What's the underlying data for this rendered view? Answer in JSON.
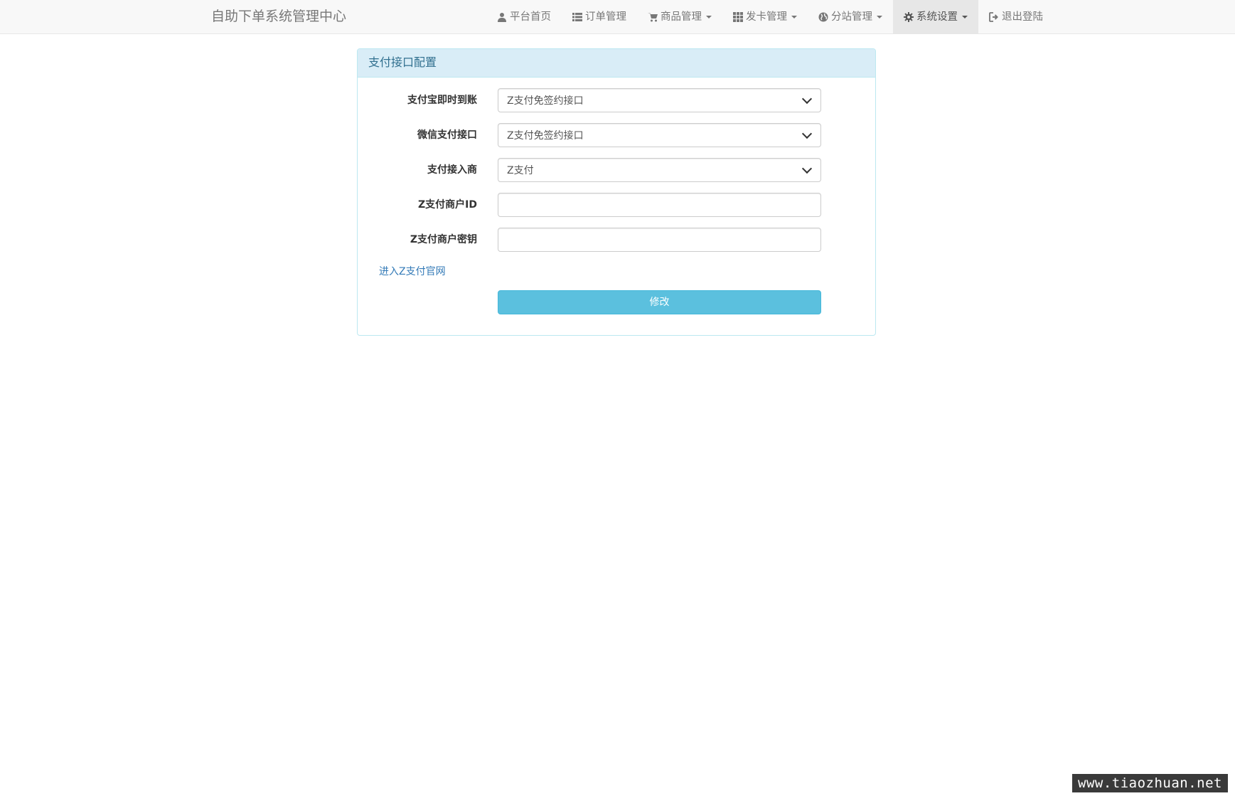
{
  "navbar": {
    "brand": "自助下单系统管理中心",
    "items": [
      {
        "label": "平台首页",
        "icon": "user-icon",
        "dropdown": false,
        "active": false
      },
      {
        "label": "订单管理",
        "icon": "list-icon",
        "dropdown": false,
        "active": false
      },
      {
        "label": "商品管理",
        "icon": "cart-icon",
        "dropdown": true,
        "active": false
      },
      {
        "label": "发卡管理",
        "icon": "grid-icon",
        "dropdown": true,
        "active": false
      },
      {
        "label": "分站管理",
        "icon": "globe-icon",
        "dropdown": true,
        "active": false
      },
      {
        "label": "系统设置",
        "icon": "gear-icon",
        "dropdown": true,
        "active": true
      },
      {
        "label": "退出登陆",
        "icon": "logout-icon",
        "dropdown": false,
        "active": false
      }
    ]
  },
  "panel": {
    "title": "支付接口配置",
    "fields": [
      {
        "label": "支付宝即时到账",
        "type": "select",
        "value": "Z支付免签约接口"
      },
      {
        "label": "微信支付接口",
        "type": "select",
        "value": "Z支付免签约接口"
      },
      {
        "label": "支付接入商",
        "type": "select",
        "value": "Z支付"
      },
      {
        "label": "Z支付商户ID",
        "type": "input",
        "value": ""
      },
      {
        "label": "Z支付商户密钥",
        "type": "input",
        "value": ""
      }
    ],
    "link": "进入Z支付官网",
    "submit": "修改"
  },
  "watermark": "www.tiaozhuan.net",
  "colors": {
    "navbar_bg": "#f8f8f8",
    "panel_heading_bg": "#d9edf7",
    "panel_heading_text": "#31708f",
    "panel_border": "#bce8f1",
    "button_bg": "#5bc0de",
    "link": "#337ab7"
  }
}
